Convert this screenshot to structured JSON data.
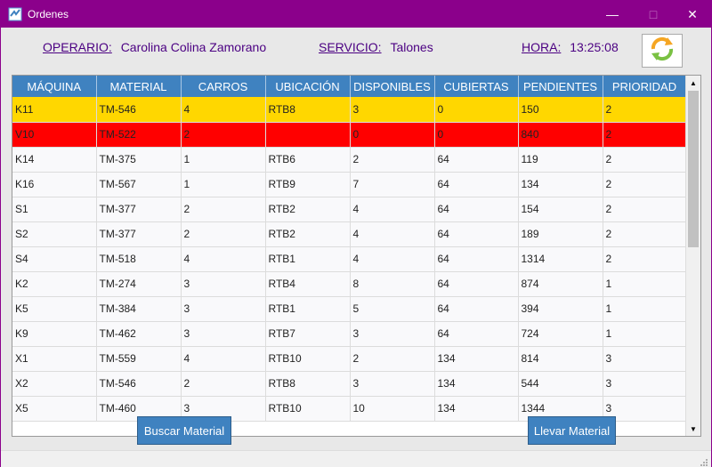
{
  "window": {
    "title": "Ordenes"
  },
  "header": {
    "operario_label": "OPERARIO:",
    "operario_value": "Carolina Colina Zamorano",
    "servicio_label": "SERVICIO:",
    "servicio_value": "Talones",
    "hora_label": "HORA:",
    "hora_value": "13:25:08"
  },
  "table": {
    "columns": [
      "MÁQUINA",
      "MATERIAL",
      "CARROS",
      "UBICACIÓN",
      "DISPONIBLES",
      "CUBIERTAS",
      "PENDIENTES",
      "PRIORIDAD"
    ],
    "rows": [
      [
        "K11",
        "TM-546",
        "4",
        "RTB8",
        "3",
        "0",
        "150",
        "2"
      ],
      [
        "V10",
        "TM-522",
        "2",
        "",
        "0",
        "0",
        "840",
        "2"
      ],
      [
        "K14",
        "TM-375",
        "1",
        "RTB6",
        "2",
        "64",
        "119",
        "2"
      ],
      [
        "K16",
        "TM-567",
        "1",
        "RTB9",
        "7",
        "64",
        "134",
        "2"
      ],
      [
        "S1",
        "TM-377",
        "2",
        "RTB2",
        "4",
        "64",
        "154",
        "2"
      ],
      [
        "S2",
        "TM-377",
        "2",
        "RTB2",
        "4",
        "64",
        "189",
        "2"
      ],
      [
        "S4",
        "TM-518",
        "4",
        "RTB1",
        "4",
        "64",
        "1314",
        "2"
      ],
      [
        "K2",
        "TM-274",
        "3",
        "RTB4",
        "8",
        "64",
        "874",
        "1"
      ],
      [
        "K5",
        "TM-384",
        "3",
        "RTB1",
        "5",
        "64",
        "394",
        "1"
      ],
      [
        "K9",
        "TM-462",
        "3",
        "RTB7",
        "3",
        "64",
        "724",
        "1"
      ],
      [
        "X1",
        "TM-559",
        "4",
        "RTB10",
        "2",
        "134",
        "814",
        "3"
      ],
      [
        "X2",
        "TM-546",
        "2",
        "RTB8",
        "3",
        "134",
        "544",
        "3"
      ],
      [
        "X5",
        "TM-460",
        "3",
        "RTB10",
        "10",
        "134",
        "1344",
        "3"
      ]
    ],
    "row_highlights": {
      "0": "yellow",
      "1": "red"
    }
  },
  "buttons": {
    "buscar": "Buscar Material",
    "llevar": "Llevar Material"
  },
  "colors": {
    "titlebar": "#8b008b",
    "header_bg": "#3f82c0",
    "highlight_yellow": "#ffd700",
    "highlight_red": "#ff0000",
    "label_text": "#4b0082"
  },
  "icons": {
    "app": "app-icon",
    "refresh": "refresh-icon",
    "minimize": "minimize-icon",
    "maximize": "maximize-icon",
    "close": "close-icon"
  }
}
